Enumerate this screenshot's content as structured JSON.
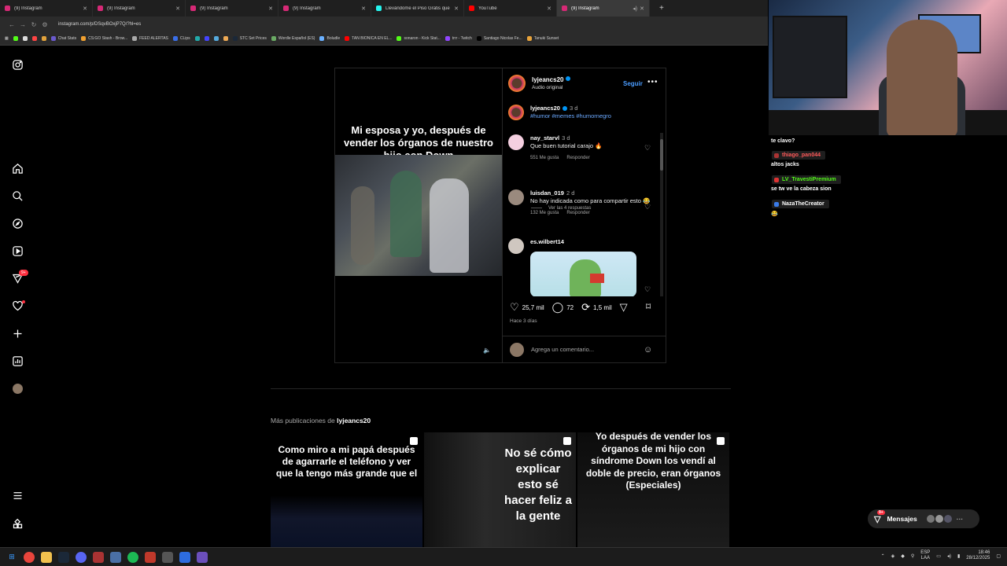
{
  "browser": {
    "tabs": [
      {
        "title": "(9) Instagram",
        "color": "#d62976"
      },
      {
        "title": "(9) Instagram",
        "color": "#d62976"
      },
      {
        "title": "(9) Instagram",
        "color": "#d62976"
      },
      {
        "title": "(9) Instagram",
        "color": "#d62976"
      },
      {
        "title": "Llevándome el Piso Gratis que",
        "color": "#25f4ee"
      },
      {
        "title": "YouTube",
        "color": "#ff0000"
      },
      {
        "title": "(9) Instagram",
        "color": "#d62976",
        "active": true
      }
    ],
    "url": "instagram.com/p/DSqvBOxjP7Q/?hl=es",
    "bookmarks": [
      "Chat Stats",
      "CS:GO Stash - Brow...",
      "FEED ALERTAS",
      "CLips",
      "STC Set Prices",
      "Wordle Español (ES)",
      "Boludle",
      "TAN BIONICA EN EL...",
      "sonaron - Kick Stat...",
      "trrr - Twitch",
      "Santiago Nicolas Fe...",
      "Tanuki Sunset"
    ]
  },
  "nav": {
    "badge": "9+"
  },
  "post": {
    "author": "lyjeancs20",
    "audio": "Audio original",
    "follow_label": "Seguir",
    "video_caption": "Mi esposa y yo, después de vender los órganos de nuestro hijo con Down",
    "comments": [
      {
        "user": "lyjeancs20",
        "time": "3 d",
        "text": "#humor #memes #humornegro"
      },
      {
        "user": "nay_starvl",
        "time": "3 d",
        "text": "Que buen tutorial carajo 🔥",
        "likes": "551 Me gusta",
        "reply": "Responder"
      },
      {
        "user": "luisdan_019",
        "time": "2 d",
        "text": "No hay indicada como para compartir esto 😂",
        "likes": "132 Me gusta",
        "reply": "Responder"
      },
      {
        "user": "es.wilbert14"
      }
    ],
    "view_replies": "Ver las 4 respuestas",
    "likes": "25,7 mil",
    "comment_count": "72",
    "reposts": "1,5 mil",
    "posted_ago": "Hace 3 días",
    "comment_placeholder": "Agrega un comentario..."
  },
  "more_posts": {
    "prefix": "Más publicaciones de",
    "author": "lyjeancs20",
    "items": [
      "Como miro a mi papá después de agarrarle el teléfono y ver que la tengo más grande que el",
      "No sé cómo explicar esto sé hacer feliz a la gente",
      "Yo después de vender los órganos de mi hijo con síndrome Down los vendí al doble de precio, eran órganos (Especiales)"
    ]
  },
  "stream_chat": {
    "lines": [
      {
        "type": "text",
        "text": "te clavo?"
      },
      {
        "type": "user",
        "user": "thiago_pan044",
        "color": "#ff5a5a"
      },
      {
        "type": "text",
        "text": "altos jacks"
      },
      {
        "type": "user",
        "user": "LV_TravestiPremium",
        "color": "#53fc18"
      },
      {
        "type": "text",
        "text": "se tw ve la cabeza sion"
      },
      {
        "type": "user",
        "user": "NazaTheCreator",
        "color": "#ffffff"
      },
      {
        "type": "text",
        "text": "😂"
      }
    ]
  },
  "messages": {
    "label": "Mensajes",
    "badge": "9+"
  },
  "taskbar": {
    "lang_top": "ESP",
    "lang_bottom": "LAA",
    "time": "18:46",
    "date": "28/12/2025"
  }
}
